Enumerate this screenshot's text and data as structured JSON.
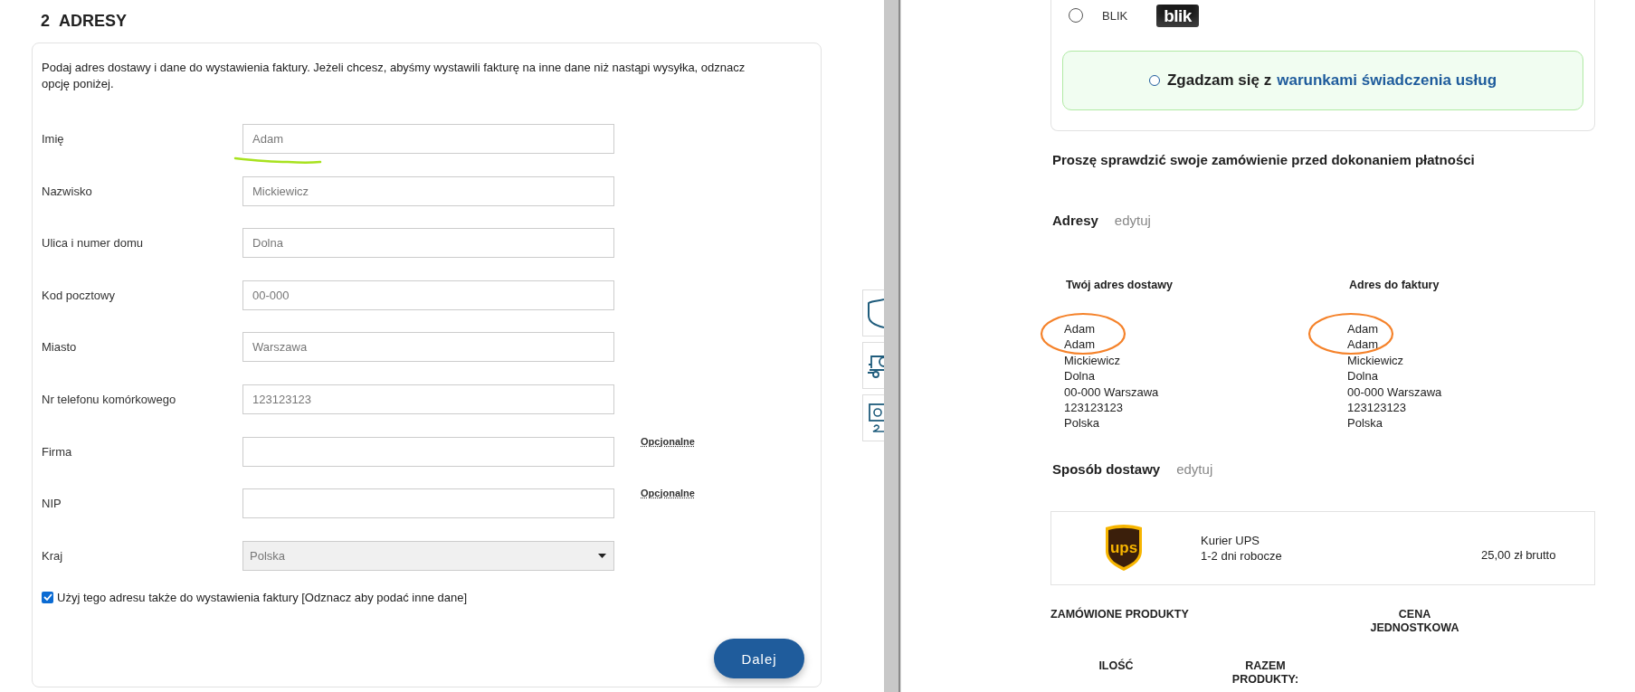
{
  "address_form": {
    "step_number": "2",
    "title": "ADRESY",
    "intro": "Podaj adres dostawy i dane do wystawienia faktury. Jeżeli chcesz, abyśmy wystawili fakturę na inne dane niż nastąpi wysyłka, odznacz opcję poniżej.",
    "fields": [
      {
        "label": "Imię",
        "placeholder": "Adam"
      },
      {
        "label": "Nazwisko",
        "placeholder": "Mickiewicz"
      },
      {
        "label": "Ulica i numer domu",
        "placeholder": "Dolna"
      },
      {
        "label": "Kod pocztowy",
        "placeholder": "00-000"
      },
      {
        "label": "Miasto",
        "placeholder": "Warszawa"
      },
      {
        "label": "Nr telefonu komórkowego",
        "placeholder": "123123123"
      },
      {
        "label": "Firma",
        "note": "Opcjonalne"
      },
      {
        "label": "NIP",
        "note": "Opcjonalne"
      }
    ],
    "country": {
      "label": "Kraj",
      "value": "Polska",
      "disabled": true
    },
    "same_address": {
      "label": "Użyj tego adresu także do wystawienia faktury [Odznacz aby podać inne dane]",
      "checked": true
    },
    "next_button": "Dalej"
  },
  "order_summary": {
    "payment_option": {
      "label": "BLIK",
      "logo_text": "blik",
      "selected": false
    },
    "terms": {
      "text": "Zgadzam się z",
      "link": "warunkami świadczenia usług",
      "checked": false
    },
    "review_note": "Proszę sprawdzić swoje zamówienie przed dokonaniem płatności",
    "addresses": {
      "title": "Adresy",
      "edit": "edytuj",
      "columns": [
        {
          "heading": "Twój adres dostawy",
          "lines": [
            "Adam",
            "Adam",
            "Mickiewicz",
            "Dolna",
            "00-000 Warszawa",
            "123123123",
            "Polska"
          ]
        },
        {
          "heading": "Adres do faktury",
          "lines": [
            "Adam",
            "Adam",
            "Mickiewicz",
            "Dolna",
            "00-000 Warszawa",
            "123123123",
            "Polska"
          ]
        }
      ]
    },
    "delivery": {
      "title": "Sposób dostawy",
      "edit": "edytuj",
      "carrier": {
        "logo_text": "ups",
        "name": "Kurier UPS",
        "time": "1-2 dni robocze",
        "price": "25,00 zł brutto"
      }
    },
    "products_table": {
      "columns": [
        "ZAMÓWIONE PRODUKTY",
        "CENA JEDNOSTKOWA",
        "ILOŚĆ",
        "RAZEM PRODUKTY:"
      ]
    }
  }
}
